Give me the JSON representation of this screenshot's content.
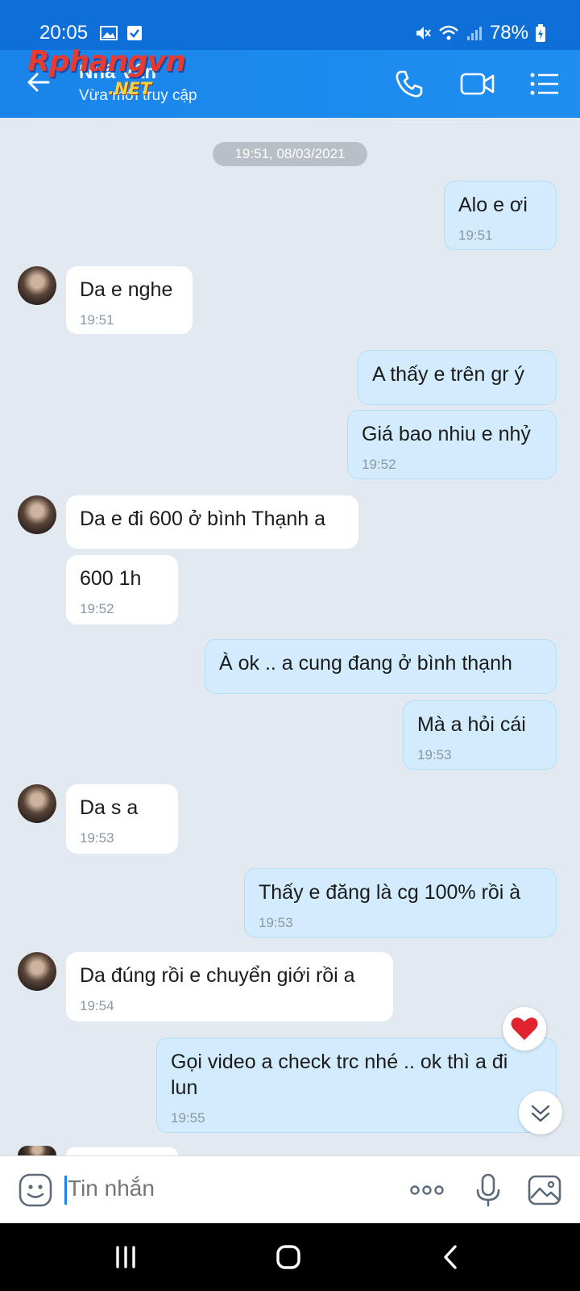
{
  "status_bar": {
    "time": "20:05",
    "battery": "78%",
    "icons": [
      "gallery-icon",
      "checkbox-icon",
      "mute-icon",
      "wifi-icon",
      "signal-icon",
      "battery-charging-icon"
    ]
  },
  "header": {
    "contact_name": "Nhã Vân",
    "status": "Vừa mới truy cập",
    "watermark_main": "Rphangvn",
    "watermark_sub": ".NET",
    "icons": [
      "back-arrow-icon",
      "phone-icon",
      "video-camera-icon",
      "menu-list-icon"
    ]
  },
  "chat": {
    "date_separator": "19:51, 08/03/2021",
    "messages": [
      {
        "sender": "me",
        "text": "Alo e ơi",
        "time": "19:51"
      },
      {
        "sender": "them",
        "text": "Da e nghe",
        "time": "19:51"
      },
      {
        "sender": "me",
        "text": "A thấy e trên gr ý",
        "time": ""
      },
      {
        "sender": "me",
        "text": "Giá bao nhiu e nhỷ",
        "time": "19:52"
      },
      {
        "sender": "them",
        "text": "Da e đi 600 ở bình Thạnh a",
        "time": ""
      },
      {
        "sender": "them",
        "text": "600 1h",
        "time": "19:52"
      },
      {
        "sender": "me",
        "text": "À ok .. a cung đang ở bình thạnh",
        "time": ""
      },
      {
        "sender": "me",
        "text": "Mà a hỏi cái",
        "time": "19:53"
      },
      {
        "sender": "them",
        "text": "Da s a",
        "time": "19:53"
      },
      {
        "sender": "me",
        "text": "Thấy e đăng là cg 100% rồi à",
        "time": "19:53"
      },
      {
        "sender": "them",
        "text": "Da đúng rồi e chuyển giới rồi a",
        "time": "19:54"
      },
      {
        "sender": "me",
        "text": "Gọi video a check trc nhé .. ok thì a đi",
        "text_line2": "lun",
        "time": "19:55"
      }
    ]
  },
  "input_bar": {
    "placeholder": "Tin nhắn",
    "icons": [
      "sticker-emoji-icon",
      "more-options-icon",
      "microphone-icon",
      "image-gallery-icon"
    ]
  },
  "floating": {
    "reaction_icon": "heart-icon",
    "scroll_icon": "double-chevron-down-icon"
  },
  "nav_bar": {
    "icons": [
      "recent-apps-icon",
      "home-icon",
      "back-icon"
    ]
  },
  "colors": {
    "accent": "#1a84ea",
    "my_bubble": "#d3ecfd",
    "their_bubble": "#ffffff",
    "background": "#e2e9f1"
  }
}
